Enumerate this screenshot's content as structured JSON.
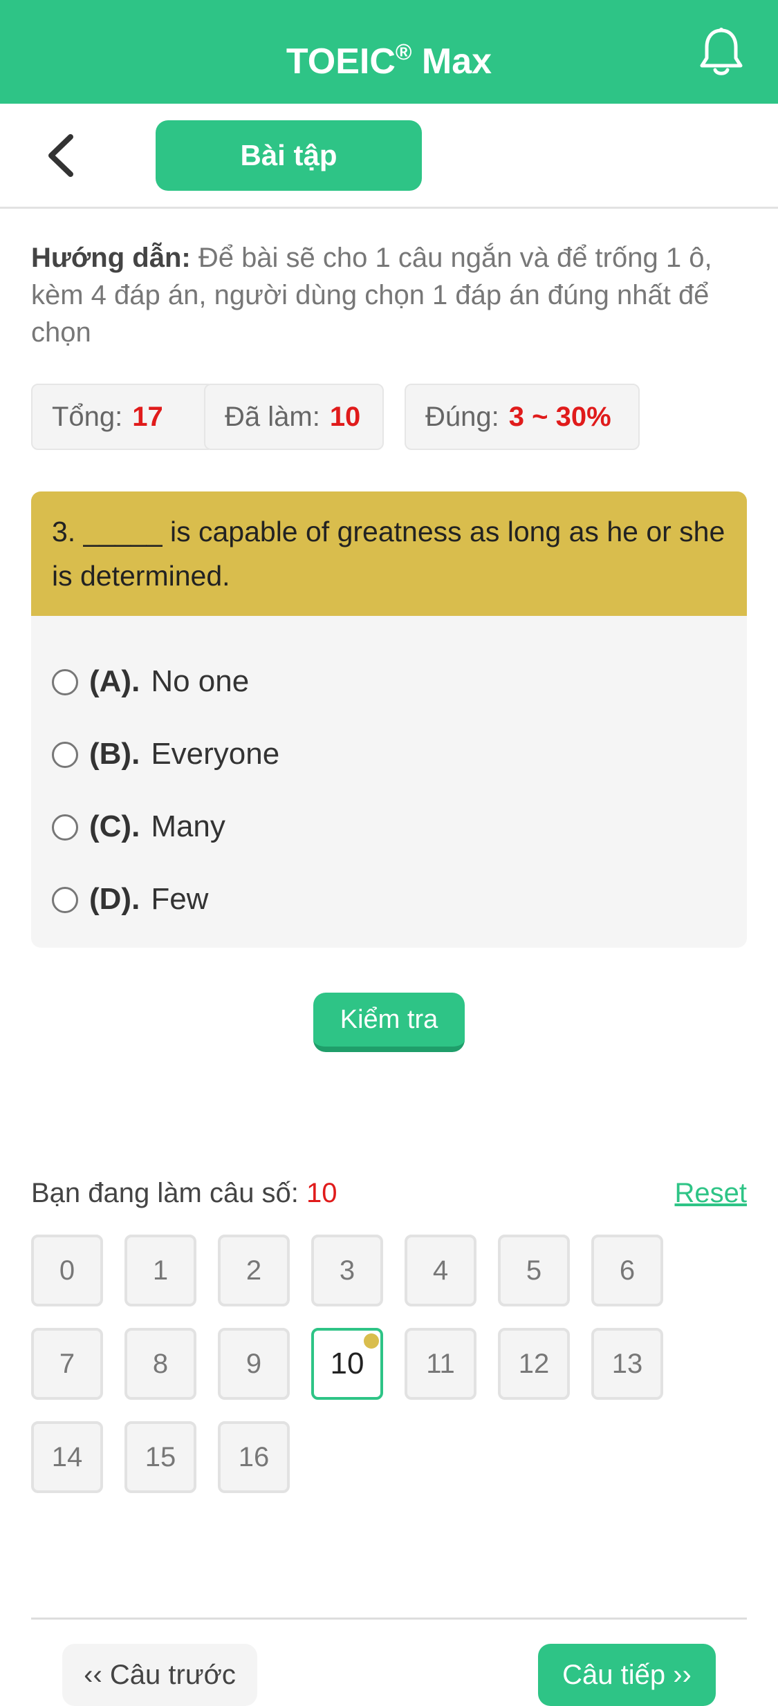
{
  "header": {
    "title": "TOEIC",
    "title_sup": "®",
    "title_suffix": " Max",
    "notification_icon": "bell-icon",
    "bg_color": "#2ec486"
  },
  "subheader": {
    "back_icon": "chevron-left-icon",
    "tab_label": "Bài tập"
  },
  "instructions": {
    "label": "Hướng dẫn:",
    "text": " Để bài sẽ cho 1 câu ngắn và để trống 1 ô, kèm 4 đáp án, người dùng chọn 1 đáp án đúng nhất để chọn"
  },
  "stats": [
    {
      "label": "Tổng:",
      "value": "17"
    },
    {
      "label": "Đã làm:",
      "value": "10"
    },
    {
      "label": "Đúng:",
      "value": "3 ~ 30%"
    }
  ],
  "question": {
    "text": "3. _____ is capable of greatness as long as he or she is determined.",
    "options": [
      {
        "letter": "(A).",
        "text": "No one"
      },
      {
        "letter": "(B).",
        "text": "Everyone"
      },
      {
        "letter": "(C).",
        "text": "Many"
      },
      {
        "letter": "(D).",
        "text": "Few"
      }
    ],
    "header_color": "#d9bd4d"
  },
  "check_button": "Kiểm tra",
  "progress": {
    "label": "Bạn đang làm câu số:",
    "current": "10",
    "reset_label": "Reset"
  },
  "question_grid": [
    "0",
    "1",
    "2",
    "3",
    "4",
    "5",
    "6",
    "7",
    "8",
    "9",
    "10",
    "11",
    "12",
    "13",
    "14",
    "15",
    "16"
  ],
  "navigation": {
    "prev_label": "‹‹ Câu trước",
    "next_label": "Câu tiếp ››"
  }
}
